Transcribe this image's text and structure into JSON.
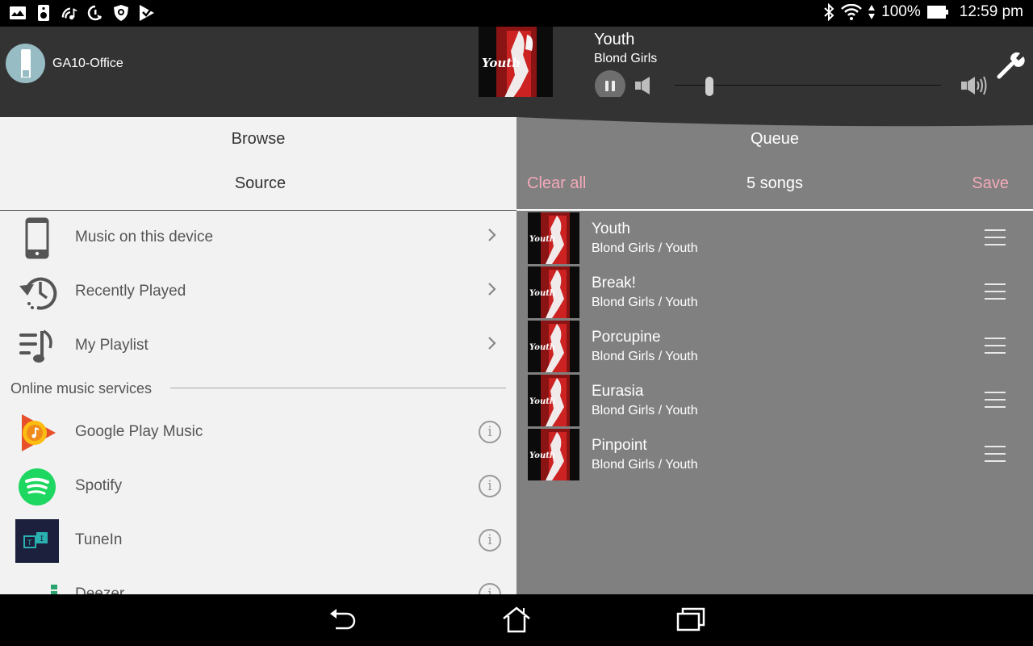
{
  "status_bar": {
    "left_icons": [
      "gallery-icon",
      "speaker-icon",
      "wifi-music-icon",
      "speed-test-icon",
      "shield-icon",
      "check-flag-icon"
    ],
    "battery_percent": "100%",
    "time": "12:59 pm",
    "right_icons": [
      "bluetooth-icon",
      "wifi-icon",
      "data-arrows-icon",
      "battery-icon"
    ]
  },
  "header": {
    "device_name": "GA10-Office",
    "now_playing": {
      "title": "Youth",
      "artist": "Blond Girls",
      "state": "playing",
      "album_art_text": "Youth"
    },
    "volume_level": 0.13
  },
  "browse": {
    "title": "Browse",
    "subtitle": "Source",
    "items": [
      {
        "label": "Music on this device",
        "icon": "phone-icon"
      },
      {
        "label": "Recently Played",
        "icon": "history-icon"
      },
      {
        "label": "My Playlist",
        "icon": "playlist-icon"
      }
    ],
    "online_section_label": "Online music services",
    "services": [
      {
        "label": "Google Play Music",
        "icon": "google-play-music-icon"
      },
      {
        "label": "Spotify",
        "icon": "spotify-icon"
      },
      {
        "label": "TuneIn",
        "icon": "tunein-icon"
      },
      {
        "label": "Deezer",
        "icon": "deezer-icon"
      }
    ]
  },
  "queue": {
    "title": "Queue",
    "clear_label": "Clear all",
    "count_label": "5 songs",
    "save_label": "Save",
    "songs": [
      {
        "title": "Youth",
        "subtitle": "Blond Girls / Youth"
      },
      {
        "title": "Break!",
        "subtitle": "Blond Girls / Youth"
      },
      {
        "title": "Porcupine",
        "subtitle": "Blond Girls / Youth"
      },
      {
        "title": "Eurasia",
        "subtitle": "Blond Girls / Youth"
      },
      {
        "title": "Pinpoint",
        "subtitle": "Blond Girls / Youth"
      }
    ]
  },
  "colors": {
    "header_bg": "#333333",
    "browse_bg": "#f2f2f2",
    "queue_bg": "#808080",
    "accent_pink": "#f3a9b8"
  }
}
